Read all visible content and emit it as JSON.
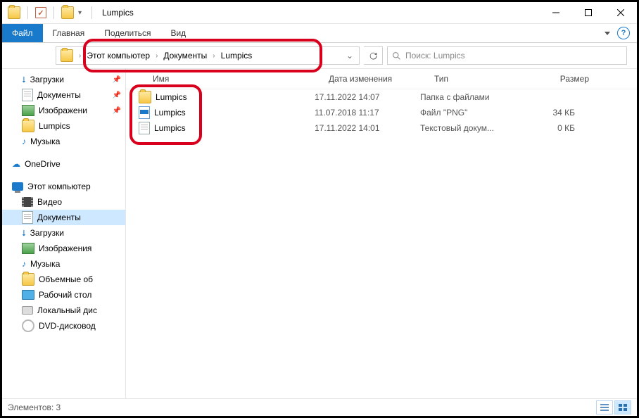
{
  "window": {
    "title": "Lumpics"
  },
  "ribbon": {
    "file": "Файл",
    "tabs": [
      "Главная",
      "Поделиться",
      "Вид"
    ]
  },
  "breadcrumb": {
    "segments": [
      "Этот компьютер",
      "Документы",
      "Lumpics"
    ]
  },
  "search": {
    "placeholder": "Поиск: Lumpics"
  },
  "sidebar": {
    "quick": [
      {
        "label": "Загрузки",
        "icon": "download",
        "pinned": true
      },
      {
        "label": "Документы",
        "icon": "doc",
        "pinned": true
      },
      {
        "label": "Изображени",
        "icon": "img",
        "pinned": true
      },
      {
        "label": "Lumpics",
        "icon": "folder",
        "pinned": false
      },
      {
        "label": "Музыка",
        "icon": "music",
        "pinned": false
      }
    ],
    "onedrive": {
      "label": "OneDrive"
    },
    "pc": {
      "label": "Этот компьютер"
    },
    "pc_children": [
      {
        "label": "Видео",
        "icon": "video"
      },
      {
        "label": "Документы",
        "icon": "doc",
        "selected": true
      },
      {
        "label": "Загрузки",
        "icon": "download"
      },
      {
        "label": "Изображения",
        "icon": "img"
      },
      {
        "label": "Музыка",
        "icon": "music"
      },
      {
        "label": "Объемные об",
        "icon": "folder"
      },
      {
        "label": "Рабочий стол",
        "icon": "desktop"
      },
      {
        "label": "Локальный дис",
        "icon": "disk"
      },
      {
        "label": "DVD-дисковод",
        "icon": "dvd"
      }
    ]
  },
  "columns": {
    "name": "Имя",
    "date": "Дата изменения",
    "type": "Тип",
    "size": "Размер"
  },
  "files": [
    {
      "name": "Lumpics",
      "date": "17.11.2022 14:07",
      "type": "Папка с файлами",
      "size": "",
      "icon": "folder"
    },
    {
      "name": "Lumpics",
      "date": "11.07.2018 11:17",
      "type": "Файл \"PNG\"",
      "size": "34 КБ",
      "icon": "png"
    },
    {
      "name": "Lumpics",
      "date": "17.11.2022 14:01",
      "type": "Текстовый докум...",
      "size": "0 КБ",
      "icon": "doc"
    }
  ],
  "status": {
    "text": "Элементов: 3"
  }
}
